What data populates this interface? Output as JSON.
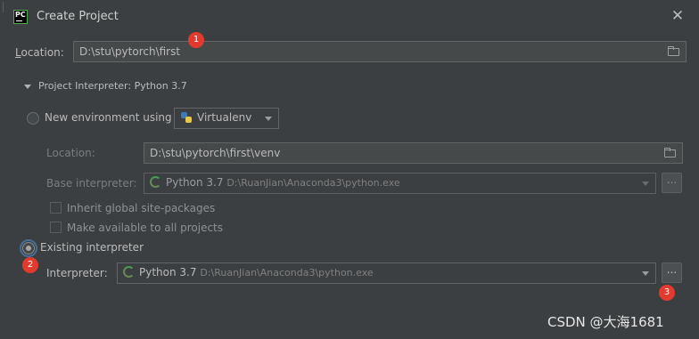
{
  "window": {
    "app_icon_text": "PC",
    "title": "Create Project",
    "close_glyph": "✕"
  },
  "location": {
    "label": "Location:",
    "label_mnemonic": "L",
    "label_rest": "ocation:",
    "value": "D:\\stu\\pytorch\\first"
  },
  "interpreter_section": {
    "header": "Project Interpreter: Python 3.7"
  },
  "new_env": {
    "radio_label": "New environment using",
    "tool_value": "Virtualenv",
    "location_label": "Location:",
    "location_value": "D:\\stu\\pytorch\\first\\venv",
    "base_label": "Base interpreter:",
    "base_name": "Python 3.7",
    "base_path": "D:\\RuanJian\\Anaconda3\\python.exe",
    "base_browse": "...",
    "inherit_label": "Inherit global site-packages",
    "available_label": "Make available to all projects"
  },
  "existing": {
    "radio_label": "Existing interpreter",
    "interpreter_label": "Interpreter:",
    "interp_name": "Python 3.7",
    "interp_path": "D:\\RuanJian\\Anaconda3\\python.exe",
    "browse": "..."
  },
  "badges": [
    "1",
    "2",
    "3"
  ],
  "watermark": "CSDN @大海1681",
  "colors": {
    "background": "#3c3f41",
    "field": "#45494a",
    "badge": "#e23a2e",
    "focus": "#466d94"
  }
}
